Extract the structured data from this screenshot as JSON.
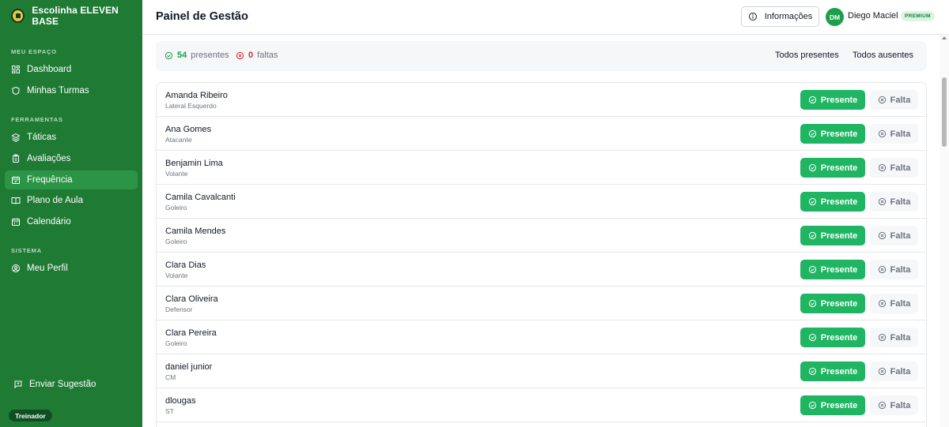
{
  "brand": {
    "name": "Escolinha ELEVEN BASE"
  },
  "sidebar": {
    "sections": [
      {
        "title": "Meu Espaço"
      },
      {
        "title": "Ferramentas"
      },
      {
        "title": "Sistema"
      }
    ],
    "items": [
      {
        "label": "Dashboard",
        "icon": "dashboard-icon"
      },
      {
        "label": "Minhas Turmas",
        "icon": "shield-icon"
      },
      {
        "label": "Táticas",
        "icon": "layers-icon"
      },
      {
        "label": "Avaliações",
        "icon": "clipboard-icon"
      },
      {
        "label": "Frequência",
        "icon": "calendar-check-icon",
        "active": true
      },
      {
        "label": "Plano de Aula",
        "icon": "book-icon"
      },
      {
        "label": "Calendário",
        "icon": "calendar-icon"
      },
      {
        "label": "Meu Perfil",
        "icon": "user-circle-icon"
      }
    ],
    "suggestion": {
      "label": "Enviar Sugestão",
      "icon": "message-icon"
    },
    "role": "Treinador"
  },
  "header": {
    "title": "Painel de Gestão",
    "info_label": "Informações",
    "user": {
      "initials": "DM",
      "name": "Diego Maciel",
      "plan": "PREMIUM"
    }
  },
  "summary": {
    "present_count": "54",
    "present_label": "presentes",
    "absent_count": "0",
    "absent_label": "faltas",
    "all_present": "Todos presentes",
    "all_absent": "Todos ausentes"
  },
  "actions": {
    "present": "Presente",
    "absent": "Falta"
  },
  "students": [
    {
      "name": "Amanda Ribeiro",
      "position": "Lateral Esquerdo"
    },
    {
      "name": "Ana Gomes",
      "position": "Atacante"
    },
    {
      "name": "Benjamin Lima",
      "position": "Volante"
    },
    {
      "name": "Camila Cavalcanti",
      "position": "Goleiro"
    },
    {
      "name": "Camila Mendes",
      "position": "Goleiro"
    },
    {
      "name": "Clara Dias",
      "position": "Volante"
    },
    {
      "name": "Clara Oliveira",
      "position": "Defensor"
    },
    {
      "name": "Clara Pereira",
      "position": "Goleiro"
    },
    {
      "name": "daniel junior",
      "position": "CM"
    },
    {
      "name": "dlougas",
      "position": "ST"
    }
  ],
  "colors": {
    "sidebar": "#1f7a34",
    "sidebar_active": "#2c9446",
    "present_button": "#1fb562",
    "absent_count": "#dc2626",
    "present_count": "#16a34a"
  }
}
